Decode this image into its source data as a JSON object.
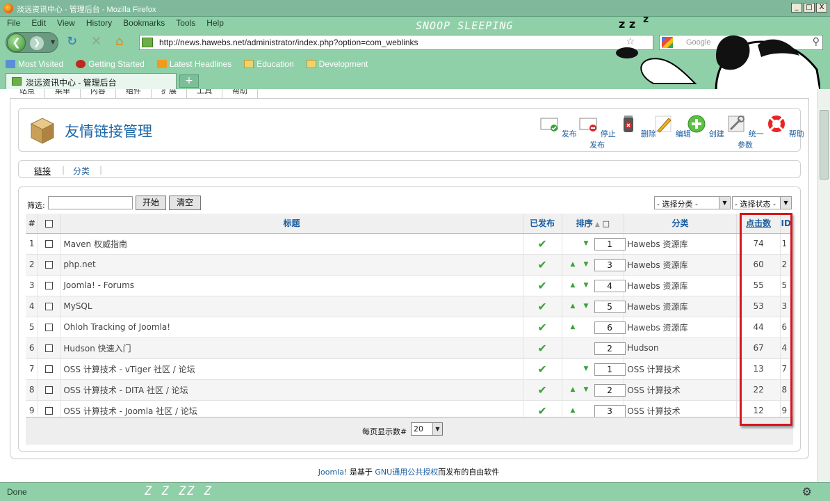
{
  "window": {
    "title": "淡远资讯中心 - 管理后台 - Mozilla Firefox",
    "min": "_",
    "max": "□",
    "close": "X"
  },
  "menubar": [
    "File",
    "Edit",
    "View",
    "History",
    "Bookmarks",
    "Tools",
    "Help"
  ],
  "theme_text": "SNOOP SLEEPING",
  "nav": {
    "url": "http://news.hawebs.net/administrator/index.php?option=com_weblinks",
    "search_placeholder": "Google"
  },
  "bookmarks": [
    "Most Visited",
    "Getting Started",
    "Latest Headlines",
    "Education",
    "Development"
  ],
  "tab": {
    "title": "淡远资讯中心 - 管理后台",
    "new_tab": "+"
  },
  "admin_menu": [
    "站点",
    "菜单",
    "内容",
    "组件",
    "扩展",
    "工具",
    "帮助"
  ],
  "header": {
    "title": "友情链接管理",
    "tools": [
      {
        "label": "发布",
        "icon": "publish-icon"
      },
      {
        "label": "停止发布",
        "icon": "unpublish-icon"
      },
      {
        "label": "删除",
        "icon": "delete-icon"
      },
      {
        "label": "编辑",
        "icon": "edit-icon"
      },
      {
        "label": "创建",
        "icon": "new-icon"
      },
      {
        "label": "统一参数",
        "icon": "parameters-icon"
      },
      {
        "label": "帮助",
        "icon": "help-icon"
      }
    ]
  },
  "submenu": {
    "links": "链接",
    "categories": "分类"
  },
  "filter": {
    "label": "筛选:",
    "value": "",
    "go": "开始",
    "reset": "清空",
    "category_select": "- 选择分类 -",
    "state_select": "- 选择状态 -"
  },
  "table": {
    "headers": {
      "num": "#",
      "title": "标题",
      "published": "已发布",
      "order": "排序",
      "category": "分类",
      "hits": "点击数",
      "id": "ID"
    },
    "rows": [
      {
        "num": "1",
        "title": "Maven 权威指南",
        "order": "1",
        "up": false,
        "down": true,
        "category": "Hawebs 资源库",
        "hits": "74",
        "id": "1"
      },
      {
        "num": "2",
        "title": "php.net",
        "order": "3",
        "up": true,
        "down": true,
        "category": "Hawebs 资源库",
        "hits": "60",
        "id": "2"
      },
      {
        "num": "3",
        "title": "Joomla! - Forums",
        "order": "4",
        "up": true,
        "down": true,
        "category": "Hawebs 资源库",
        "hits": "55",
        "id": "5"
      },
      {
        "num": "4",
        "title": "MySQL",
        "order": "5",
        "up": true,
        "down": true,
        "category": "Hawebs 资源库",
        "hits": "53",
        "id": "3"
      },
      {
        "num": "5",
        "title": "Ohloh Tracking of Joomla!",
        "order": "6",
        "up": true,
        "down": false,
        "category": "Hawebs 资源库",
        "hits": "44",
        "id": "6"
      },
      {
        "num": "6",
        "title": "Hudson 快速入门",
        "order": "2",
        "up": false,
        "down": false,
        "category": "Hudson",
        "hits": "67",
        "id": "4"
      },
      {
        "num": "7",
        "title": "OSS 计算技术 - vTiger 社区 / 论坛",
        "order": "1",
        "up": false,
        "down": true,
        "category": "OSS 计算技术",
        "hits": "13",
        "id": "7"
      },
      {
        "num": "8",
        "title": "OSS 计算技术 - DITA 社区 / 论坛",
        "order": "2",
        "up": true,
        "down": true,
        "category": "OSS 计算技术",
        "hits": "22",
        "id": "8"
      },
      {
        "num": "9",
        "title": "OSS 计算技术 - Joomla 社区 / 论坛",
        "order": "3",
        "up": true,
        "down": false,
        "category": "OSS 计算技术",
        "hits": "12",
        "id": "9"
      }
    ]
  },
  "pagination": {
    "label": "每页显示数#",
    "value": "20"
  },
  "footer": {
    "link1": "Joomla!",
    "text1": " 是基于 ",
    "link2": "GNU通用公共授权",
    "text2": "而发布的自由软件"
  },
  "status": {
    "text": "Done",
    "zz": "Z Z ZZ Z"
  },
  "colors": {
    "chrome": "#8fd0a8",
    "link": "#1b5ea0",
    "highlight": "#d9161c"
  }
}
